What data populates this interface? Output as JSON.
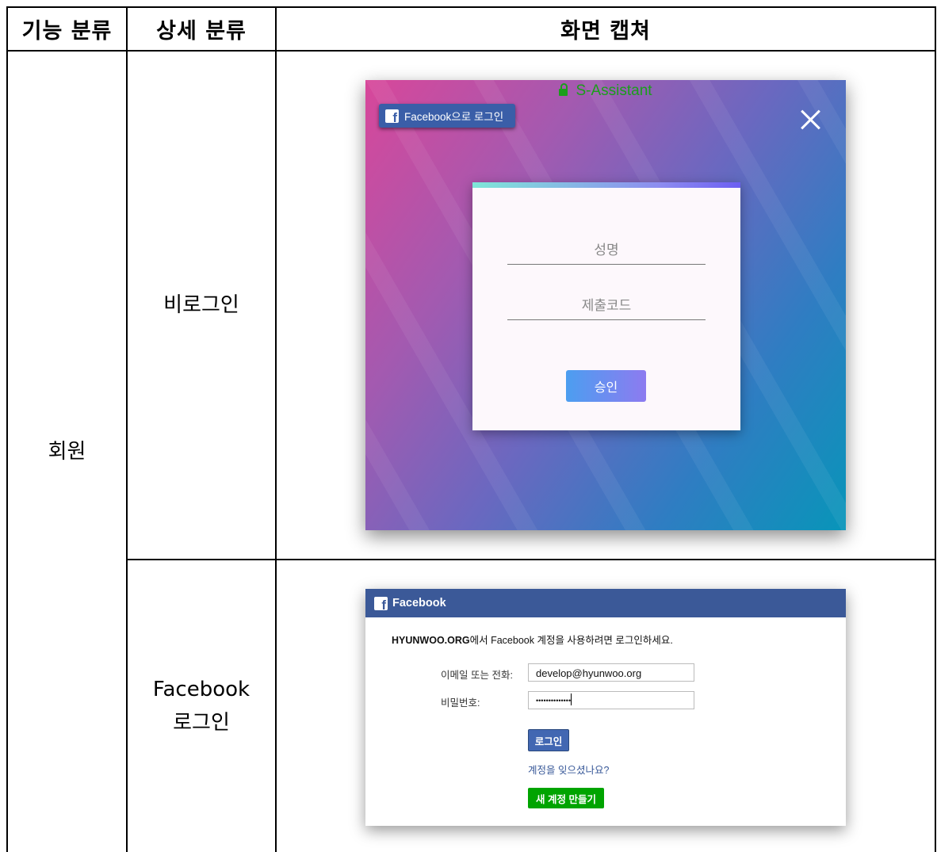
{
  "table": {
    "headers": [
      "기능 분류",
      "상세 분류",
      "화면 캡쳐"
    ],
    "feature_category": "회원",
    "rows": [
      {
        "subcategory_lines": [
          "비로그인"
        ]
      },
      {
        "subcategory_lines": [
          "Facebook",
          "로그인"
        ]
      }
    ]
  },
  "screen_login": {
    "brand": "S-Assistant",
    "fb_button_label": "Facebook으로 로그인",
    "name_placeholder": "성명",
    "code_placeholder": "제출코드",
    "approve_button": "승인"
  },
  "screen_facebook": {
    "header_title": "Facebook",
    "message_site": "HYUNWOO.ORG",
    "message_rest": "에서 Facebook 계정을 사용하려면 로그인하세요.",
    "email_label": "이메일 또는 전화:",
    "email_value": "develop@hyunwoo.org",
    "password_label": "비밀번호:",
    "password_masked": "••••••••••••••",
    "login_button": "로그인",
    "forgot_link": "계정을 잊으셨나요?",
    "create_button": "새 계정 만들기"
  },
  "colors": {
    "facebook_blue": "#3b5998",
    "brand_green": "#1a9e1a",
    "create_green": "#00a400"
  }
}
